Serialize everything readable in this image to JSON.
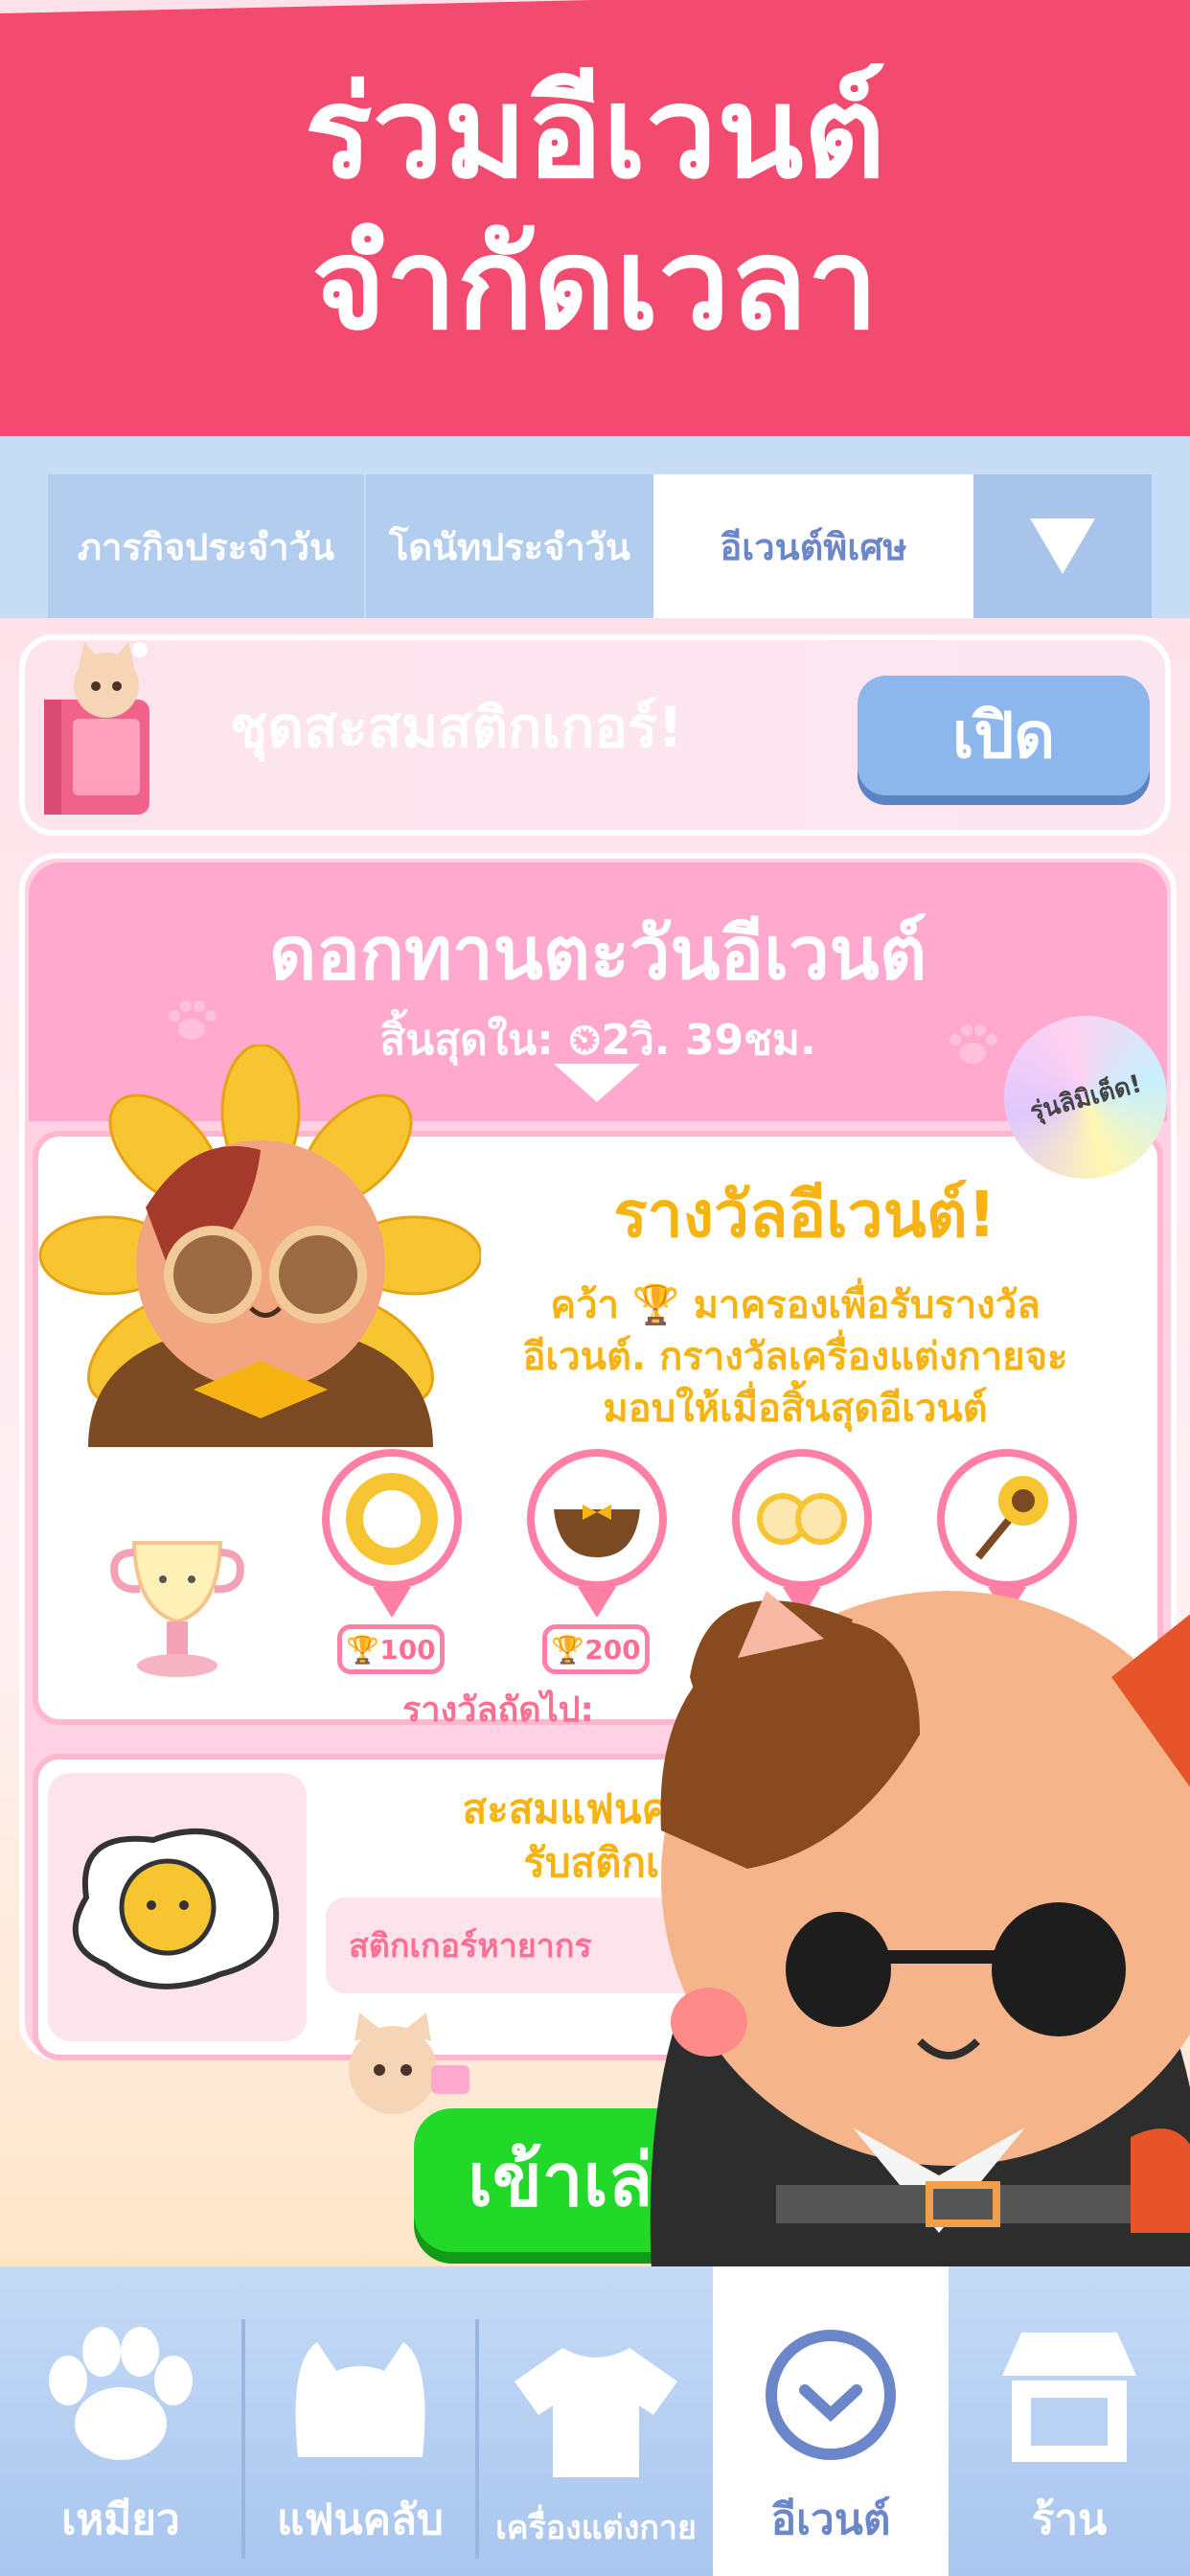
{
  "banner": {
    "line1": "ร่วมอีเวนต์",
    "line2": "จำกัดเวลา"
  },
  "tabs": {
    "daily": "ภารกิจประจำวัน",
    "bonus": "โดนัทประจำวัน",
    "special": "อีเวนต์พิเศษ",
    "more_icon": "triangle-down-icon"
  },
  "sticker": {
    "title": "ชุดสะสมสติกเกอร์!",
    "open_button": "เปิด"
  },
  "event": {
    "title": "ดอกทานตะวันอีเวนต์",
    "countdown": "สิ้นสุดใน: ⏲2วิ. 39ชม.",
    "limited_badge": "รุ่นลิมิเต็ด!",
    "reward_title": "รางวัลอีเวนต์!",
    "reward_desc": "คว้า 🏆 มาครองเพื่อรับรางวัล\nอีเวนต์. กรางวัลเครื่องแต่งกายจะ\nมอบให้เมื่อสิ้นสุดอีเวนต์",
    "rewards": [
      {
        "points": "🏆100",
        "icon": "sunflower-collar-icon"
      },
      {
        "points": "🏆200",
        "icon": "bow-basket-icon"
      },
      {
        "points": "",
        "icon": "sunflower-glasses-icon"
      },
      {
        "points": "",
        "icon": "sunflower-wand-icon"
      }
    ],
    "next_reward": "รางวัลถัดไป:"
  },
  "collect": {
    "text": "สะสมแฟนคลับต\nรับสติกเก",
    "rare": "สติกเกอร์หายากร"
  },
  "join_button": "เข้าเล่",
  "nav": [
    {
      "label": "เหมียว",
      "icon": "paw-icon"
    },
    {
      "label": "แฟนคลับ",
      "icon": "cat-head-icon"
    },
    {
      "label": "เครื่องแต่งกาย",
      "icon": "shirt-icon"
    },
    {
      "label": "อีเวนต์",
      "icon": "clock-icon"
    },
    {
      "label": "ร้าน",
      "icon": "shop-icon"
    }
  ],
  "colors": {
    "banner": "#f24b6f",
    "accent": "#f6b312",
    "pink": "#ff7fa5",
    "join": "#22d92a",
    "nav": "#a9c6ef"
  }
}
